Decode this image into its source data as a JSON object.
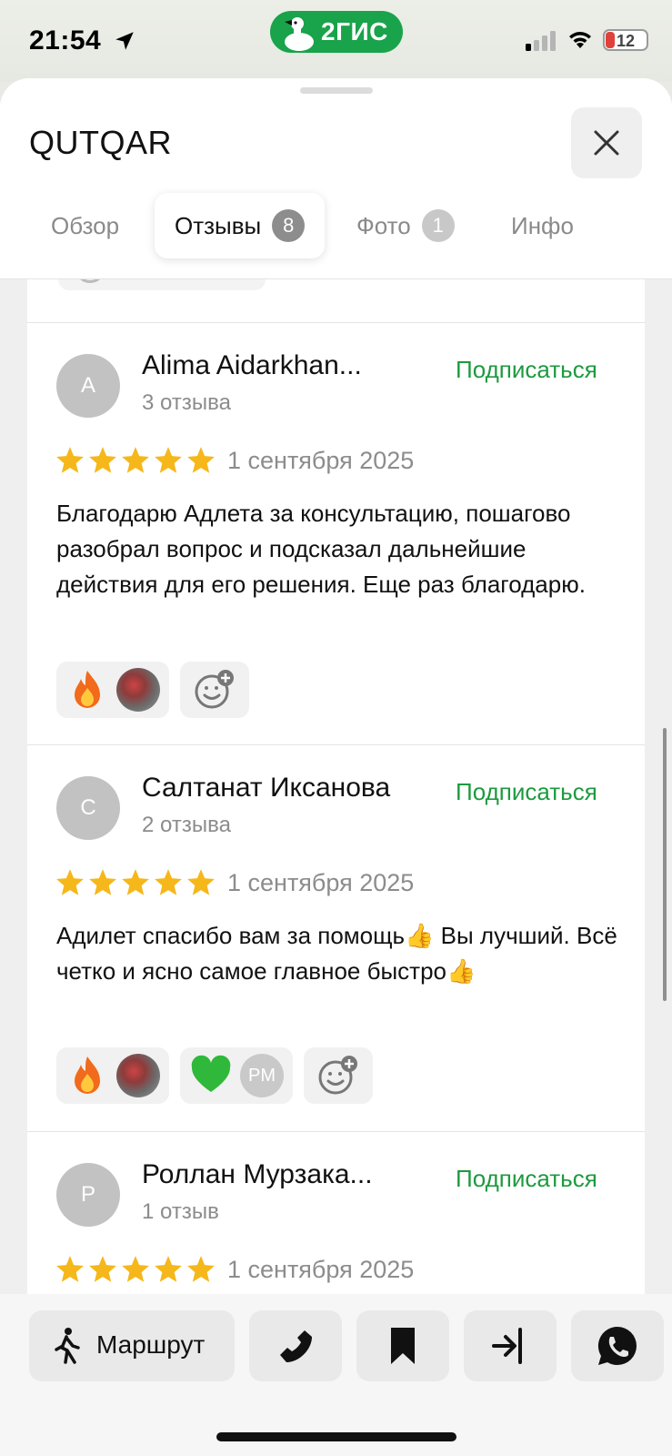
{
  "status_bar": {
    "time": "21:54",
    "brand": "2ГИС",
    "battery_level": "12",
    "battery_color": "#e0423b"
  },
  "header": {
    "title": "QUTQAR",
    "close_icon": "close-icon"
  },
  "tabs": [
    {
      "label": "Обзор"
    },
    {
      "label": "Отзывы",
      "count": "8",
      "active": true
    },
    {
      "label": "Фото",
      "count": "1"
    },
    {
      "label": "Инфо"
    }
  ],
  "reviews": [
    {
      "avatar_letter": "A",
      "name": "Alima Aidarkhan...",
      "review_count": "3 отзыва",
      "subscribe_label": "Подписаться",
      "rating": 5,
      "date": "1 сентября 2025",
      "text": "Благодарю Адлета за консультацию, пошагово разобрал вопрос и подсказал дальнейшие действия для его решения. Еще раз благодарю.",
      "reactions": [
        "fire-icon"
      ]
    },
    {
      "avatar_letter": "С",
      "name": "Салтанат Иксанова",
      "review_count": "2 отзыва",
      "subscribe_label": "Подписаться",
      "rating": 5,
      "date": "1 сентября 2025",
      "text": "Адилет спасибо вам за помощь👍 Вы лучший. Всё четко и ясно самое главное быстро👍",
      "reactions": [
        "fire-icon",
        "green-heart-icon"
      ],
      "reactor_initials": "PM"
    },
    {
      "avatar_letter": "Р",
      "name": "Роллан Мурзака...",
      "review_count": "1 отзыв",
      "subscribe_label": "Подписаться",
      "rating": 5,
      "date": "1 сентября 2025"
    }
  ],
  "bottom_bar": {
    "route_label": "Маршрут",
    "buttons": [
      "walk-icon",
      "phone-icon",
      "bookmark-icon",
      "share-icon",
      "whatsapp-icon"
    ]
  },
  "colors": {
    "accent_green": "#1d9a3f",
    "brand_green": "#19a34a",
    "star": "#f5b71a"
  }
}
